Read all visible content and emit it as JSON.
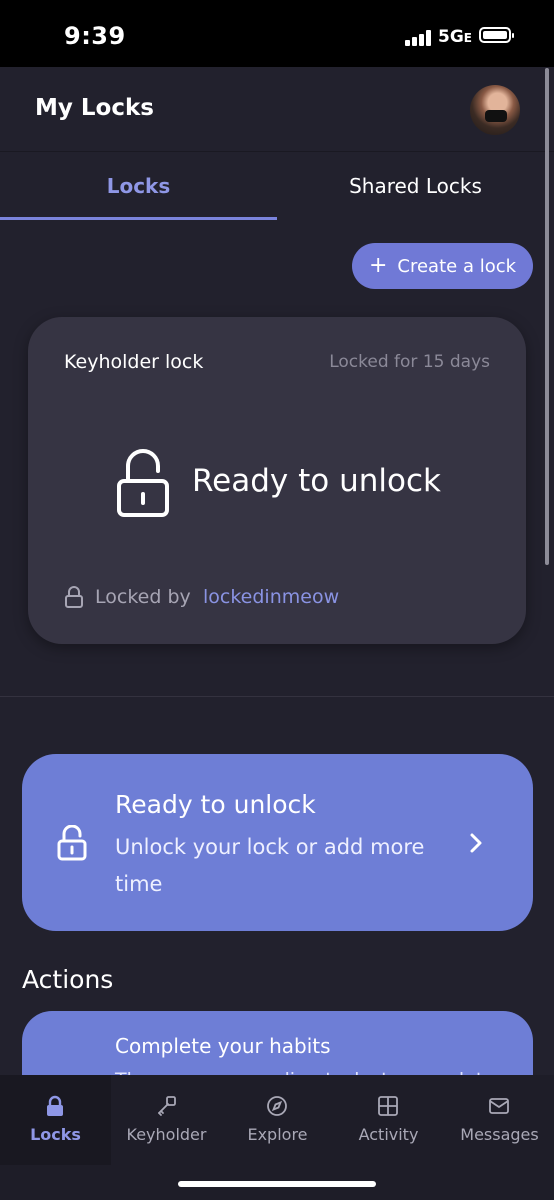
{
  "status_bar": {
    "time": "9:39",
    "network": "5G",
    "network_suffix": "E"
  },
  "header": {
    "title": "My Locks"
  },
  "tabs": [
    {
      "label": "Locks",
      "active": true
    },
    {
      "label": "Shared Locks",
      "active": false
    }
  ],
  "create_button": {
    "icon": "plus-icon",
    "label": "Create a lock"
  },
  "lock_card": {
    "type": "Keyholder lock",
    "duration": "Locked for 15 days",
    "status": "Ready to unlock",
    "locked_by_label": "Locked by",
    "locked_by_user": "lockedinmeow"
  },
  "banner": {
    "title": "Ready to unlock",
    "subtitle": "Unlock your lock or add more time"
  },
  "actions": {
    "title": "Actions",
    "items": [
      {
        "title": "Complete your habits",
        "subtitle": "There are no pending tasks to complete"
      }
    ]
  },
  "bottom_nav": [
    {
      "label": "Locks",
      "icon": "lock-icon",
      "active": true
    },
    {
      "label": "Keyholder",
      "icon": "key-icon",
      "active": false
    },
    {
      "label": "Explore",
      "icon": "compass-icon",
      "active": false
    },
    {
      "label": "Activity",
      "icon": "grid-icon",
      "active": false
    },
    {
      "label": "Messages",
      "icon": "envelope-icon",
      "active": false
    }
  ],
  "colors": {
    "accent": "#7079d6",
    "background": "#22212d",
    "card": "#363443",
    "banner": "#6e7ed6",
    "link": "#8a93e3"
  }
}
